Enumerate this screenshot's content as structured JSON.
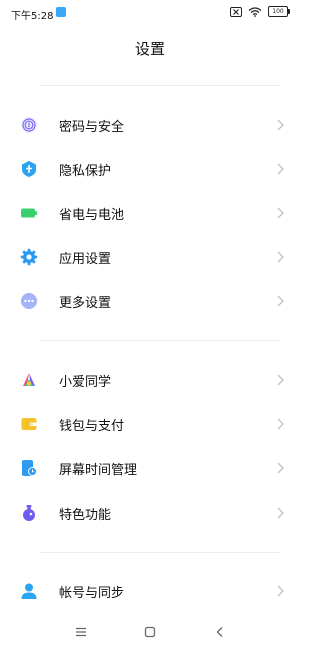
{
  "status_bar": {
    "time": "下午5:28",
    "battery": "100"
  },
  "header": {
    "title": "设置"
  },
  "groups": [
    {
      "items": [
        {
          "label": "密码与安全",
          "icon": "fingerprint-icon",
          "color": "#7b6cf5"
        },
        {
          "label": "隐私保护",
          "icon": "shield-icon",
          "color": "#2aa3f2"
        },
        {
          "label": "省电与电池",
          "icon": "battery-icon",
          "color": "#3ccf6f"
        },
        {
          "label": "应用设置",
          "icon": "gear-icon",
          "color": "#2a9af0"
        },
        {
          "label": "更多设置",
          "icon": "more-dots-icon",
          "color": "#8ea0f5"
        }
      ]
    },
    {
      "items": [
        {
          "label": "小爱同学",
          "icon": "xiaoai-icon",
          "color": "#ff4d6d"
        },
        {
          "label": "钱包与支付",
          "icon": "wallet-icon",
          "color": "#f5c22a"
        },
        {
          "label": "屏幕时间管理",
          "icon": "screen-time-icon",
          "color": "#2f9bf0"
        },
        {
          "label": "特色功能",
          "icon": "flask-icon",
          "color": "#6f5cf0"
        }
      ]
    },
    {
      "items": [
        {
          "label": "帐号与同步",
          "icon": "account-icon",
          "color": "#2aa3f2"
        }
      ]
    }
  ],
  "nav": {
    "menu_icon": "menu-icon",
    "home_icon": "home-icon",
    "back_icon": "back-icon"
  }
}
